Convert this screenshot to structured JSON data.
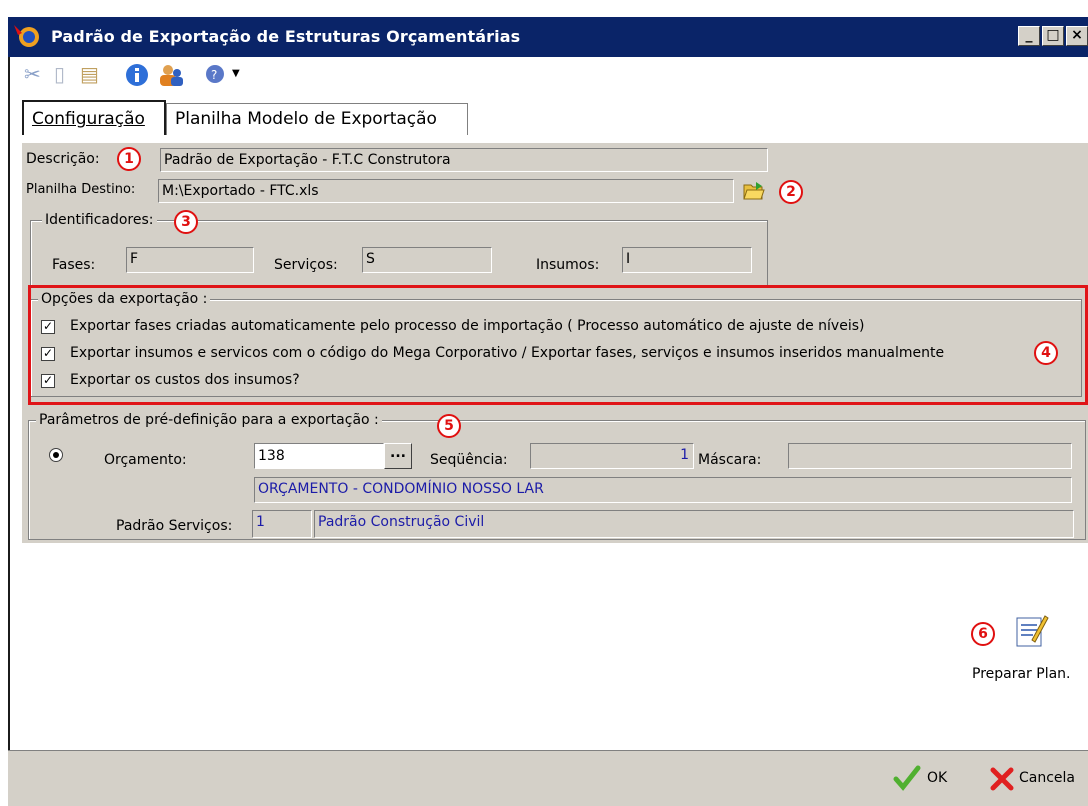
{
  "window": {
    "title": "Padrão de Exportação de Estruturas Orçamentárias"
  },
  "toolbar": {
    "icons": [
      "cut-icon",
      "copy-icon",
      "paste-icon",
      "info-icon",
      "users-icon",
      "help-icon",
      "dropdown-arrow-icon"
    ]
  },
  "tabs": [
    {
      "label": "Configuração",
      "active": true
    },
    {
      "label": "Planilha Modelo de Exportação",
      "active": false
    }
  ],
  "form": {
    "descricao_label": "Descrição:",
    "descricao_value": "Padrão de Exportação - F.T.C Construtora",
    "planilha_label": "Planilha Destino:",
    "planilha_value": "M:\\Exportado - FTC.xls",
    "identificadores_legend": "Identificadores:",
    "fases_label": "Fases:",
    "fases_value": "F",
    "servicos_label": "Serviços:",
    "servicos_value": "S",
    "insumos_label": "Insumos:",
    "insumos_value": "I"
  },
  "options": {
    "legend": "Opções da exportação :",
    "items": [
      {
        "label": "Exportar fases criadas automaticamente pelo processo de importação ( Processo automático de ajuste de níveis)",
        "checked": true
      },
      {
        "label": "Exportar insumos e servicos com o código do Mega Corporativo / Exportar fases, serviços e insumos inseridos manualmente",
        "checked": true
      },
      {
        "label": "Exportar os custos dos insumos?",
        "checked": true
      }
    ]
  },
  "params": {
    "legend": "Parâmetros de pré-definição para a exportação :",
    "orcamento_label": "Orçamento:",
    "orcamento_value": "138",
    "ellipsis": "...",
    "sequencia_label": "Seqüência:",
    "sequencia_value": "1",
    "mascara_label": "Máscara:",
    "mascara_value": "",
    "orcamento_desc": "ORÇAMENTO - CONDOMÍNIO NOSSO LAR",
    "padrao_label": "Padrão Serviços:",
    "padrao_code": "1",
    "padrao_desc": "Padrão Construção Civil"
  },
  "actions": {
    "preparar_label": "Preparar Plan.",
    "ok_label": "OK",
    "cancel_label": "Cancela"
  },
  "annotations": [
    "1",
    "2",
    "3",
    "4",
    "5",
    "6"
  ],
  "colors": {
    "titlebar": "#0a2468",
    "annotation": "#e01010",
    "panel": "#d4d0c8"
  }
}
